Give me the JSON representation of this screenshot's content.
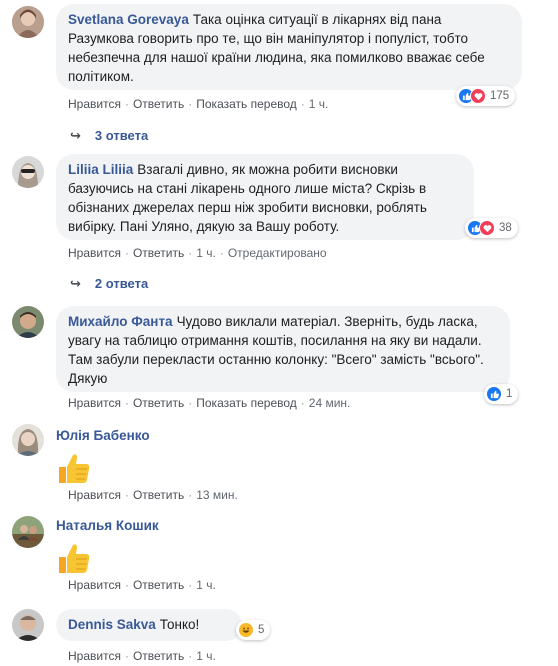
{
  "comments": [
    {
      "author": "Svetlana Gorevaya",
      "text": "Така оцінка ситуації в лікарнях від пана Разумкова говорить про те, що він маніпулятор і популіст, тобто небезпечна для нашої країни людина, яка помилково вважає себе політиком.",
      "actions": {
        "like": "Нравится",
        "reply": "Ответить",
        "translate": "Показать перевод",
        "time": "1 ч."
      },
      "reactions": {
        "count": "175",
        "icons": [
          "like-icon",
          "love-icon"
        ]
      },
      "replies": "3 ответа"
    },
    {
      "author": "Liliia Liliia",
      "text": "Взагалі дивно, як можна робити висновки базуючись на стані лікарень одного лише міста? Скрізь в обізнаних джерелах перш ніж зробити висновки, роблять вибірку. Пані Уляно, дякую за Вашу роботу.",
      "actions": {
        "like": "Нравится",
        "reply": "Ответить",
        "time": "1 ч.",
        "edited": "Отредактировано"
      },
      "reactions": {
        "count": "38",
        "icons": [
          "like-icon",
          "love-icon"
        ]
      },
      "replies": "2 ответа"
    },
    {
      "author": "Михайло Фанта",
      "text": "Чудово виклали матеріал. Зверніть, будь ласка, увагу на таблицю отримання коштів, посилання на яку ви надали. Там забули перекласти останню колонку: \"Всего\" замість \"всього\". Дякую",
      "actions": {
        "like": "Нравится",
        "reply": "Ответить",
        "translate": "Показать перевод",
        "time": "24 мин."
      },
      "reactions": {
        "count": "1",
        "icons": [
          "like-icon"
        ]
      }
    },
    {
      "author": "Юлія Бабенко",
      "sticker": "thumbs-up-icon",
      "actions": {
        "like": "Нравится",
        "reply": "Ответить",
        "time": "13 мин."
      }
    },
    {
      "author": "Наталья Кошик",
      "sticker": "thumbs-up-icon",
      "actions": {
        "like": "Нравится",
        "reply": "Ответить",
        "time": "1 ч."
      }
    },
    {
      "author": "Dennis Sakva",
      "text": "Тонко!",
      "actions": {
        "like": "Нравится",
        "reply": "Ответить",
        "time": "1 ч."
      },
      "reactions": {
        "count": "5",
        "icons": [
          "laughing-face-icon"
        ]
      }
    }
  ],
  "colors": {
    "link": "#385898",
    "bubble": "#f2f3f5",
    "like": "#1877f2",
    "love": "#f33e58",
    "haha": "#f7b928"
  }
}
